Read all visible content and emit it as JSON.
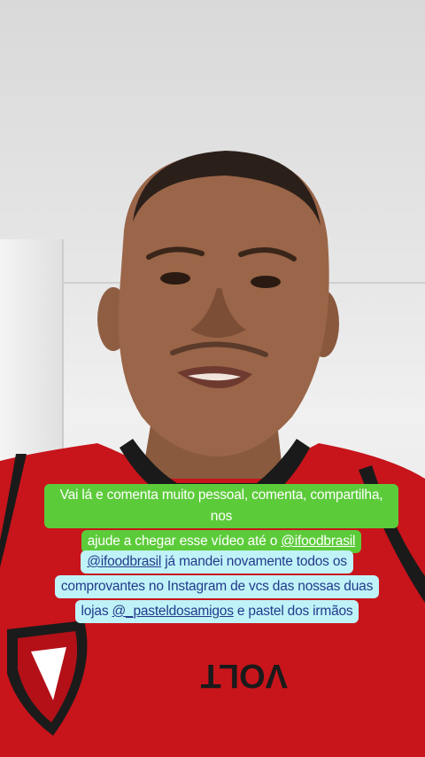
{
  "captions": {
    "green": {
      "line1": "Vai lá e comenta muito pessoal, comenta, compartilha, nos",
      "line2_pre": "ajude a chegar esse vídeo até o ",
      "line2_mention": "@ifoodbrasil"
    },
    "cyan": {
      "line1_mention": "@ifoodbrasil",
      "line1_rest": " já mandei novamente todos os",
      "line2": "comprovantes no Instagram de vcs das nossas duas",
      "line3_pre": "lojas ",
      "line3_mention": "@_pasteldosamigos",
      "line3_post": " e pastel dos irmãos"
    }
  },
  "shirt": {
    "brand": "VOLT",
    "color": "#c8141b"
  },
  "colors": {
    "green_bg": "#5ccb3a",
    "cyan_bg": "#bff3f8",
    "cyan_text": "#243a8a"
  }
}
